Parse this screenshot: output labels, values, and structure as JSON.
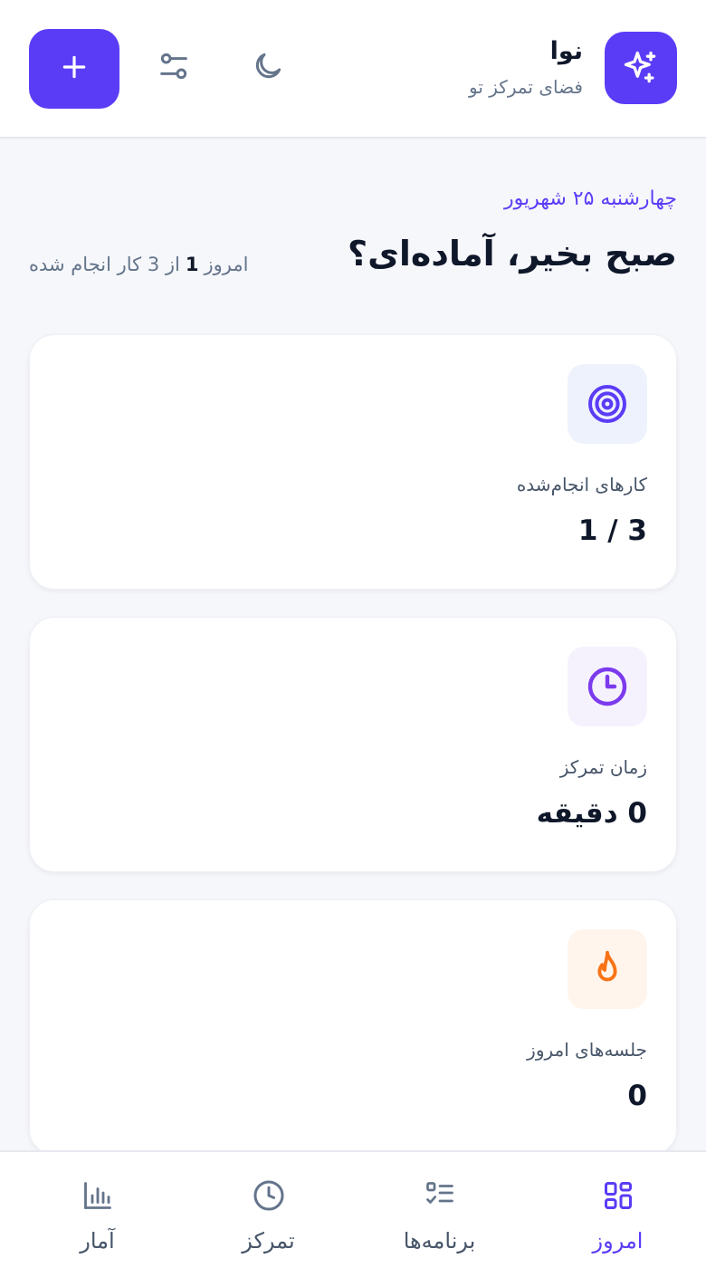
{
  "header": {
    "brand_name": "نوا",
    "brand_subtitle": "فضای تمرکز تو",
    "icons": {
      "logo": "sparkles-icon",
      "theme": "moon-icon",
      "filters": "sliders-icon",
      "add": "plus-icon"
    },
    "accent_color": "#5b3cf6"
  },
  "greeting": {
    "date": "چهارشنبه ۲۵ شهریور",
    "title": "صبح بخیر، آماده‌ای؟",
    "progress_prefix": "امروز",
    "progress_done": "1",
    "progress_suffix": "از 3 کار انجام شده"
  },
  "cards": [
    {
      "icon": "target-icon",
      "label": "کارهای انجام‌شده",
      "value": "3 / 1",
      "icon_color": "#5b3cf6",
      "icon_bg": "#eef2fd"
    },
    {
      "icon": "clock-icon",
      "label": "زمان تمرکز",
      "value": "0 دقیقه",
      "icon_color": "#7c3aed",
      "icon_bg": "#f5f2fe"
    },
    {
      "icon": "flame-icon",
      "label": "جلسه‌های امروز",
      "value": "0",
      "icon_color": "#f97316",
      "icon_bg": "#fff5ec"
    }
  ],
  "nav": {
    "items": [
      {
        "label": "امروز",
        "icon": "grid-icon",
        "active": true
      },
      {
        "label": "برنامه‌ها",
        "icon": "list-check-icon",
        "active": false
      },
      {
        "label": "تمرکز",
        "icon": "clock-icon",
        "active": false
      },
      {
        "label": "آمار",
        "icon": "bar-chart-icon",
        "active": false
      }
    ]
  }
}
